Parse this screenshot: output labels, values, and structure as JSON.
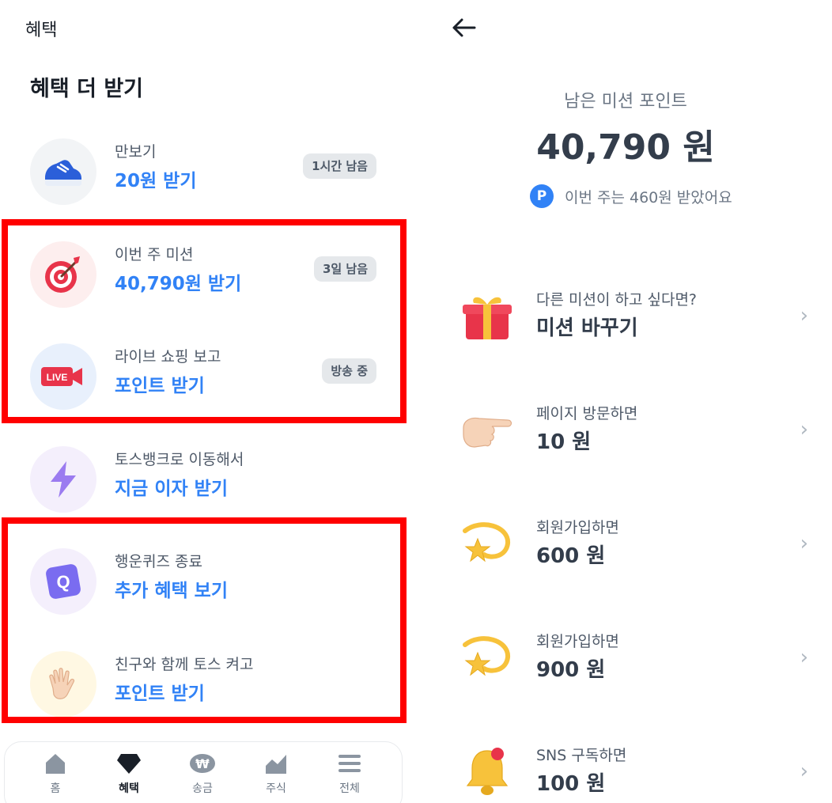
{
  "left": {
    "topbar_title": "혜택",
    "section_title": "혜택 더 받기",
    "items": [
      {
        "sub": "만보기",
        "main": "20원 받기",
        "badge": "1시간 남음",
        "icon": "shoe-icon"
      },
      {
        "sub": "이번 주 미션",
        "main": "40,790원 받기",
        "badge": "3일 남음",
        "icon": "target-icon"
      },
      {
        "sub": "라이브 쇼핑 보고",
        "main": "포인트 받기",
        "badge": "방송 중",
        "icon": "live-camera-icon",
        "live_text": "LIVE"
      },
      {
        "sub": "토스뱅크로 이동해서",
        "main": "지금 이자 받기",
        "icon": "lightning-icon"
      },
      {
        "sub": "행운퀴즈 종료",
        "main": "추가 혜택 보기",
        "icon": "quiz-icon",
        "quiz_letter": "Q"
      },
      {
        "sub": "친구와 함께 토스 켜고",
        "main": "포인트 받기",
        "icon": "waving-hand-icon"
      }
    ],
    "tabs": [
      {
        "label": "홈",
        "icon": "home-icon"
      },
      {
        "label": "혜택",
        "icon": "gem-icon",
        "active": true
      },
      {
        "label": "송금",
        "icon": "won-icon",
        "won": "₩"
      },
      {
        "label": "주식",
        "icon": "chart-icon"
      },
      {
        "label": "전체",
        "icon": "menu-icon"
      }
    ]
  },
  "right": {
    "label": "남은 미션 포인트",
    "amount": "40,790 원",
    "week_text": "이번 주는 460원 받았어요",
    "p_letter": "P",
    "items": [
      {
        "sub": "다른 미션이 하고 싶다면?",
        "main": "미션 바꾸기",
        "icon": "gift-icon"
      },
      {
        "sub": "페이지 방문하면",
        "main": "10 원",
        "icon": "pointing-hand-icon"
      },
      {
        "sub": "회원가입하면",
        "main": "600 원",
        "icon": "shooting-star-icon"
      },
      {
        "sub": "회원가입하면",
        "main": "900 원",
        "icon": "shooting-star-icon"
      },
      {
        "sub": "SNS 구독하면",
        "main": "100 원",
        "icon": "bell-icon"
      }
    ],
    "chevron": "›"
  },
  "colors": {
    "accent": "#3182f6",
    "highlight": "#ff0000",
    "badge_bg": "#e5e8eb"
  }
}
